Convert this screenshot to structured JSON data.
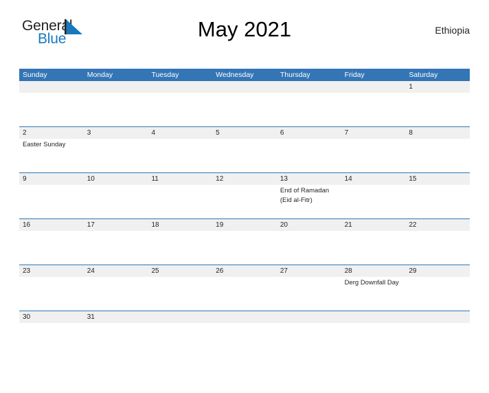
{
  "brand": {
    "logo_word_1": "General",
    "logo_word_2": "Blue",
    "logo_accent_color": "#1878be",
    "logo_text_color": "#231f20"
  },
  "header": {
    "title": "May 2021",
    "country": "Ethiopia"
  },
  "theme": {
    "header_bar_color": "#3375b5",
    "row_divider_color": "#2e75b6",
    "date_band_color": "#f0f0f0",
    "text_color": "#231f20"
  },
  "weekdays": [
    "Sunday",
    "Monday",
    "Tuesday",
    "Wednesday",
    "Thursday",
    "Friday",
    "Saturday"
  ],
  "weeks": [
    {
      "days": [
        {
          "num": "",
          "events": []
        },
        {
          "num": "",
          "events": []
        },
        {
          "num": "",
          "events": []
        },
        {
          "num": "",
          "events": []
        },
        {
          "num": "",
          "events": []
        },
        {
          "num": "",
          "events": []
        },
        {
          "num": "1",
          "events": []
        }
      ]
    },
    {
      "days": [
        {
          "num": "2",
          "events": [
            "Easter Sunday"
          ]
        },
        {
          "num": "3",
          "events": []
        },
        {
          "num": "4",
          "events": []
        },
        {
          "num": "5",
          "events": []
        },
        {
          "num": "6",
          "events": []
        },
        {
          "num": "7",
          "events": []
        },
        {
          "num": "8",
          "events": []
        }
      ]
    },
    {
      "days": [
        {
          "num": "9",
          "events": []
        },
        {
          "num": "10",
          "events": []
        },
        {
          "num": "11",
          "events": []
        },
        {
          "num": "12",
          "events": []
        },
        {
          "num": "13",
          "events": [
            "End of Ramadan",
            "(Eid al-Fitr)"
          ]
        },
        {
          "num": "14",
          "events": []
        },
        {
          "num": "15",
          "events": []
        }
      ]
    },
    {
      "days": [
        {
          "num": "16",
          "events": []
        },
        {
          "num": "17",
          "events": []
        },
        {
          "num": "18",
          "events": []
        },
        {
          "num": "19",
          "events": []
        },
        {
          "num": "20",
          "events": []
        },
        {
          "num": "21",
          "events": []
        },
        {
          "num": "22",
          "events": []
        }
      ]
    },
    {
      "days": [
        {
          "num": "23",
          "events": []
        },
        {
          "num": "24",
          "events": []
        },
        {
          "num": "25",
          "events": []
        },
        {
          "num": "26",
          "events": []
        },
        {
          "num": "27",
          "events": []
        },
        {
          "num": "28",
          "events": [
            "Derg Downfall Day"
          ]
        },
        {
          "num": "29",
          "events": []
        }
      ]
    },
    {
      "days": [
        {
          "num": "30",
          "events": []
        },
        {
          "num": "31",
          "events": []
        },
        {
          "num": "",
          "events": []
        },
        {
          "num": "",
          "events": []
        },
        {
          "num": "",
          "events": []
        },
        {
          "num": "",
          "events": []
        },
        {
          "num": "",
          "events": []
        }
      ]
    }
  ]
}
